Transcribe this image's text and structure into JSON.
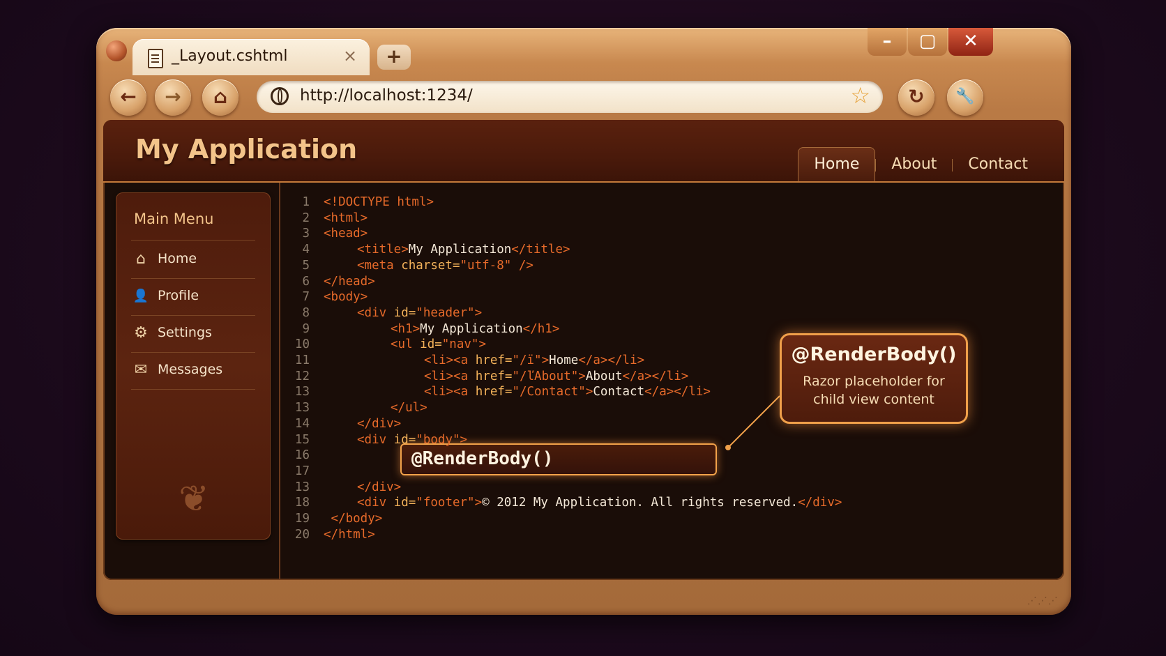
{
  "browser": {
    "tab_title": "_Layout.cshtml",
    "tab_close": "×",
    "new_tab": "+",
    "url": "http://localhost:1234/",
    "window_controls": {
      "minimize": "–",
      "maximize": "▢",
      "close": "✕"
    },
    "nav": {
      "back": "←",
      "forward": "→",
      "home": "⌂",
      "refresh": "↻",
      "tools": "🔧"
    },
    "bookmark_icon": "☆"
  },
  "app": {
    "title": "My Application",
    "nav": [
      "Home",
      "About",
      "Contact"
    ],
    "active_nav": "Home"
  },
  "sidebar": {
    "title": "Main Menu",
    "items": [
      {
        "label": "Home",
        "icon": "home-icon",
        "glyph": "⌂"
      },
      {
        "label": "Profile",
        "icon": "user-icon",
        "glyph": "👤"
      },
      {
        "label": "Settings",
        "icon": "gear-icon",
        "glyph": "⚙"
      },
      {
        "label": "Messages",
        "icon": "envelope-icon",
        "glyph": "✉"
      }
    ],
    "ornament": "❦"
  },
  "code": {
    "lines": [
      {
        "n": "1",
        "indent": 0,
        "parts": [
          [
            "tag",
            "<!DOCTYPE html>"
          ]
        ]
      },
      {
        "n": "2",
        "indent": 0,
        "parts": [
          [
            "tag",
            "<html>"
          ]
        ]
      },
      {
        "n": "3",
        "indent": 0,
        "parts": [
          [
            "tag",
            "<head>"
          ]
        ]
      },
      {
        "n": "4",
        "indent": 1,
        "parts": [
          [
            "tag",
            "<title>"
          ],
          [
            "txt",
            "My Application"
          ],
          [
            "tag",
            "</title>"
          ]
        ]
      },
      {
        "n": "5",
        "indent": 1,
        "parts": [
          [
            "tag",
            "<meta "
          ],
          [
            "attr",
            "charset="
          ],
          [
            "str",
            "\"utf-8\""
          ],
          [
            "tag",
            " />"
          ]
        ]
      },
      {
        "n": "6",
        "indent": 0,
        "parts": [
          [
            "tag",
            "</head>"
          ]
        ]
      },
      {
        "n": "7",
        "indent": 0,
        "parts": [
          [
            "tag",
            "<body>"
          ]
        ]
      },
      {
        "n": "8",
        "indent": 1,
        "parts": [
          [
            "tag",
            "<div "
          ],
          [
            "attr",
            "id="
          ],
          [
            "str",
            "\"header\""
          ],
          [
            "tag",
            ">"
          ]
        ]
      },
      {
        "n": "9",
        "indent": 2,
        "parts": [
          [
            "tag",
            "<h1>"
          ],
          [
            "txt",
            "My Application"
          ],
          [
            "tag",
            "</h1>"
          ]
        ]
      },
      {
        "n": "10",
        "indent": 2,
        "parts": [
          [
            "tag",
            "<ul "
          ],
          [
            "attr",
            "id="
          ],
          [
            "str",
            "\"nav\""
          ],
          [
            "tag",
            ">"
          ]
        ]
      },
      {
        "n": "11",
        "indent": 3,
        "parts": [
          [
            "tag",
            "<li><a "
          ],
          [
            "attr",
            "href="
          ],
          [
            "str",
            "\"/ï\""
          ],
          [
            "tag",
            ">"
          ],
          [
            "txt",
            "Home"
          ],
          [
            "tag",
            "</a></li>"
          ]
        ]
      },
      {
        "n": "12",
        "indent": 3,
        "parts": [
          [
            "tag",
            "<li><a "
          ],
          [
            "attr",
            "href="
          ],
          [
            "str",
            "\"/ľAbout\""
          ],
          [
            "tag",
            ">"
          ],
          [
            "txt",
            "About"
          ],
          [
            "tag",
            "</a></li>"
          ]
        ]
      },
      {
        "n": "13",
        "indent": 3,
        "parts": [
          [
            "tag",
            "<li><a "
          ],
          [
            "attr",
            "href="
          ],
          [
            "str",
            "\"/Contact\""
          ],
          [
            "tag",
            ">"
          ],
          [
            "txt",
            "Contact"
          ],
          [
            "tag",
            "</a></li>"
          ]
        ]
      },
      {
        "n": "13",
        "indent": 2,
        "parts": [
          [
            "tag",
            "</ul>"
          ]
        ]
      },
      {
        "n": "14",
        "indent": 1,
        "parts": [
          [
            "tag",
            "</div>"
          ]
        ]
      },
      {
        "n": "15",
        "indent": 1,
        "parts": [
          [
            "tag",
            "<div "
          ],
          [
            "attr",
            "id="
          ],
          [
            "str",
            "\"body\""
          ],
          [
            "tag",
            ">"
          ]
        ]
      },
      {
        "n": "16",
        "indent": 0,
        "parts": []
      },
      {
        "n": "17",
        "indent": 0,
        "parts": []
      },
      {
        "n": "13",
        "indent": 1,
        "parts": [
          [
            "tag",
            "</div>"
          ]
        ]
      },
      {
        "n": "18",
        "indent": 1,
        "parts": [
          [
            "tag",
            "<div "
          ],
          [
            "attr",
            "id="
          ],
          [
            "str",
            "\"footer\""
          ],
          [
            "tag",
            ">"
          ],
          [
            "txt",
            "© 2012 My Application. All rights reserved."
          ],
          [
            "tag",
            "</div>"
          ]
        ]
      },
      {
        "n": "19",
        "indent": 0,
        "parts": [
          [
            "tag",
            " </body>"
          ]
        ]
      },
      {
        "n": "20",
        "indent": 0,
        "parts": [
          [
            "tag",
            "</html>"
          ]
        ]
      }
    ],
    "render_body": "@RenderBody()"
  },
  "callout": {
    "heading": "@RenderBody()",
    "line1": "Razor placeholder for",
    "line2": "child view content"
  },
  "colors": {
    "accent": "#f0a04a",
    "tag": "#e66a2a",
    "attr": "#f3b25a",
    "text": "#f5e9d8"
  }
}
